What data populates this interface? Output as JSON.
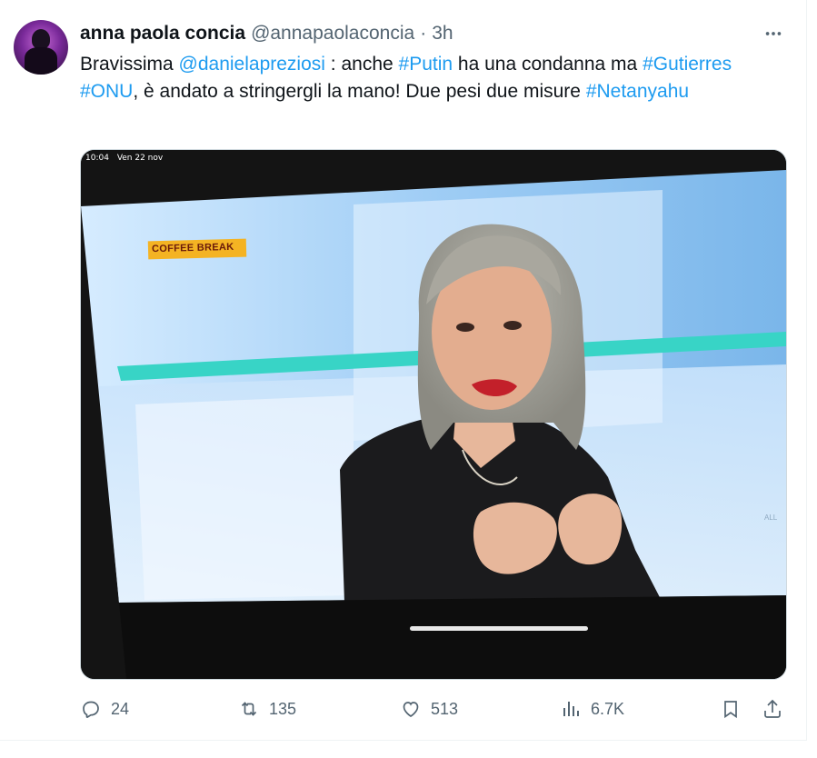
{
  "tweet": {
    "author": {
      "name": "anna paola concia",
      "handle": "@annapaolaconcia",
      "separator": "·",
      "time": "3h"
    },
    "text": {
      "p1": "Bravissima ",
      "mention": "@danielapreziosi",
      "p2": " : anche ",
      "tag_putin": "#Putin",
      "p3": " ha una condanna ma ",
      "tag_gutierres": "#Gutierres",
      "p4": " ",
      "tag_onu": "#ONU",
      "p5": ", è andato a stringergli la mano! Due pesi due misure ",
      "tag_netanyahu": "#Netanyahu"
    },
    "media": {
      "status_time": "10:04",
      "status_date": "Ven 22 nov",
      "program_label": "COFFEE BREAK",
      "ticker_text": "ALL"
    },
    "actions": {
      "replies": "24",
      "reposts": "135",
      "likes": "513",
      "views": "6.7K"
    },
    "colors": {
      "accent": "#1d9bf0",
      "muted": "#536471",
      "text": "#0f1419"
    },
    "icons": [
      "more-icon",
      "reply-icon",
      "repost-icon",
      "like-icon",
      "views-icon",
      "bookmark-icon",
      "share-icon"
    ]
  }
}
